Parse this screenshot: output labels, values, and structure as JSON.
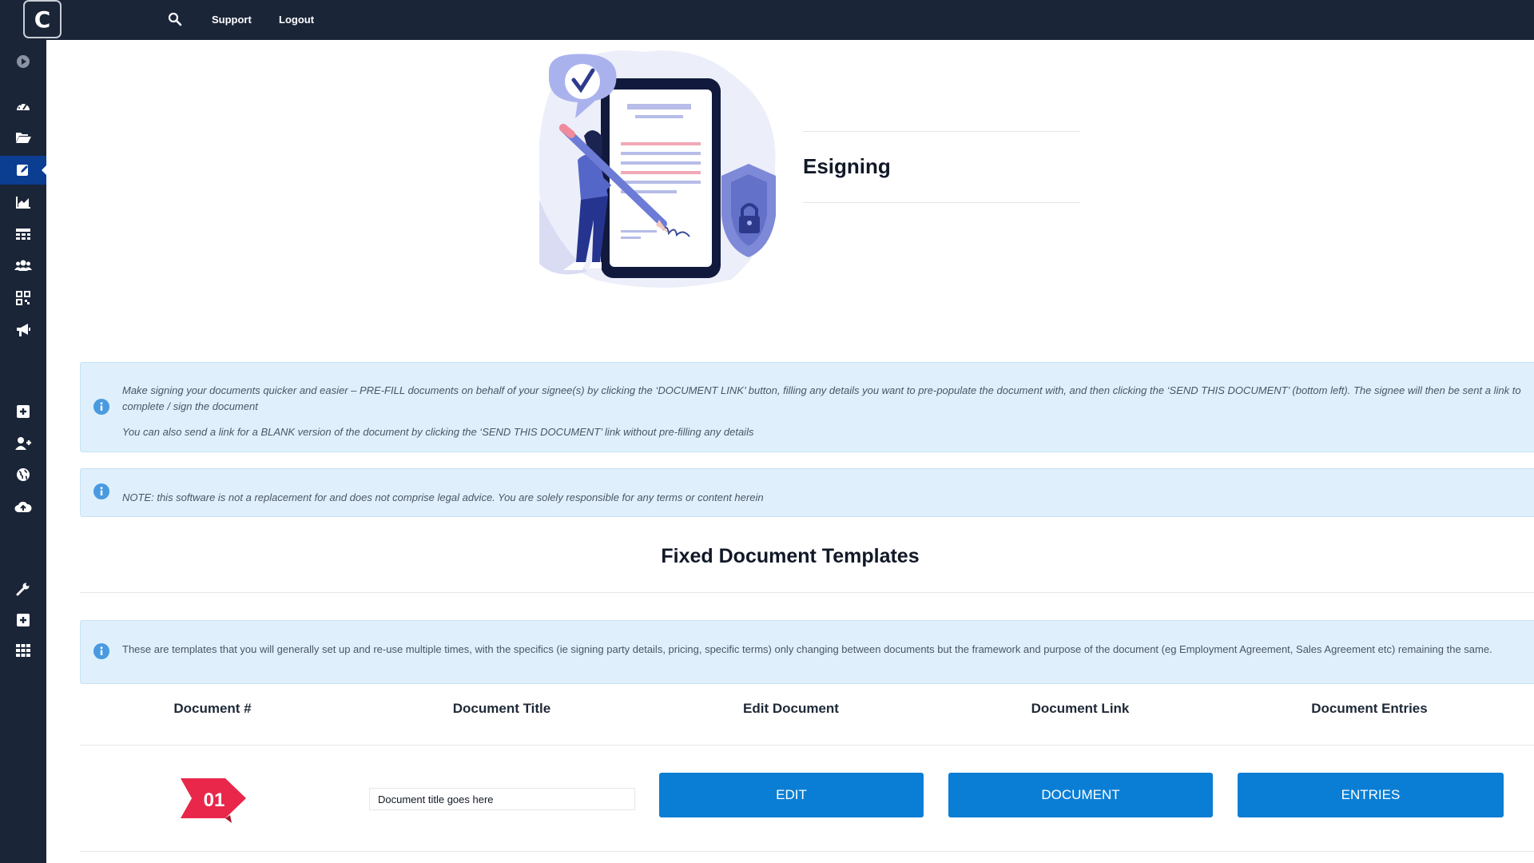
{
  "topbar": {
    "logo_letter": "C",
    "support_label": "Support",
    "logout_label": "Logout"
  },
  "sidebar": {
    "items": [
      {
        "icon": "play-circle-icon"
      },
      {
        "icon": "dashboard-icon"
      },
      {
        "icon": "folder-open-icon"
      },
      {
        "icon": "edit-document-icon",
        "active": true
      },
      {
        "icon": "chart-area-icon"
      },
      {
        "icon": "table-icon"
      },
      {
        "icon": "users-icon"
      },
      {
        "icon": "qr-code-icon"
      },
      {
        "icon": "megaphone-icon"
      },
      {
        "icon": "plus-square-icon"
      },
      {
        "icon": "user-plus-icon"
      },
      {
        "icon": "globe-icon"
      },
      {
        "icon": "cloud-upload-icon"
      },
      {
        "icon": "wrench-icon"
      },
      {
        "icon": "plus-square-icon"
      },
      {
        "icon": "grid-icon"
      }
    ]
  },
  "header": {
    "title": "Esigning"
  },
  "info_boxes": {
    "prefill_line1": "Make signing your documents quicker and easier – PRE-FILL documents on behalf of your signee(s) by clicking the ‘DOCUMENT LINK’ button, filling any details you want to pre-populate the document with, and then clicking the ‘SEND THIS DOCUMENT’ (bottom left). The signee will then be sent a link to complete / sign the document",
    "prefill_line2": "You can also send a link for a BLANK version of the document by clicking the ‘SEND THIS DOCUMENT’ link without pre-filling any details",
    "note": "NOTE: this software is not a replacement for and does not comprise legal advice. You are solely responsible for any terms or content herein",
    "templates": "These are templates that you will generally set up and re-use multiple times, with the specifics (ie signing party details, pricing, specific terms) only changing between documents but the framework and purpose of the document (eg Employment Agreement, Sales Agreement etc) remaining the same."
  },
  "section": {
    "title": "Fixed Document Templates"
  },
  "table": {
    "columns": [
      "Document #",
      "Document Title",
      "Edit Document",
      "Document Link",
      "Document Entries"
    ],
    "rows": [
      {
        "number": "01",
        "title_value": "Document title goes here",
        "edit_label": "EDIT",
        "document_label": "DOCUMENT",
        "entries_label": "ENTRIES"
      }
    ]
  },
  "colors": {
    "sidebar_bg": "#1a2538",
    "active_item": "#0b3d91",
    "info_bg": "#dff0fc",
    "button_blue": "#0a7ed4",
    "badge_red": "#e8274b",
    "info_icon": "#4a9ae0"
  }
}
